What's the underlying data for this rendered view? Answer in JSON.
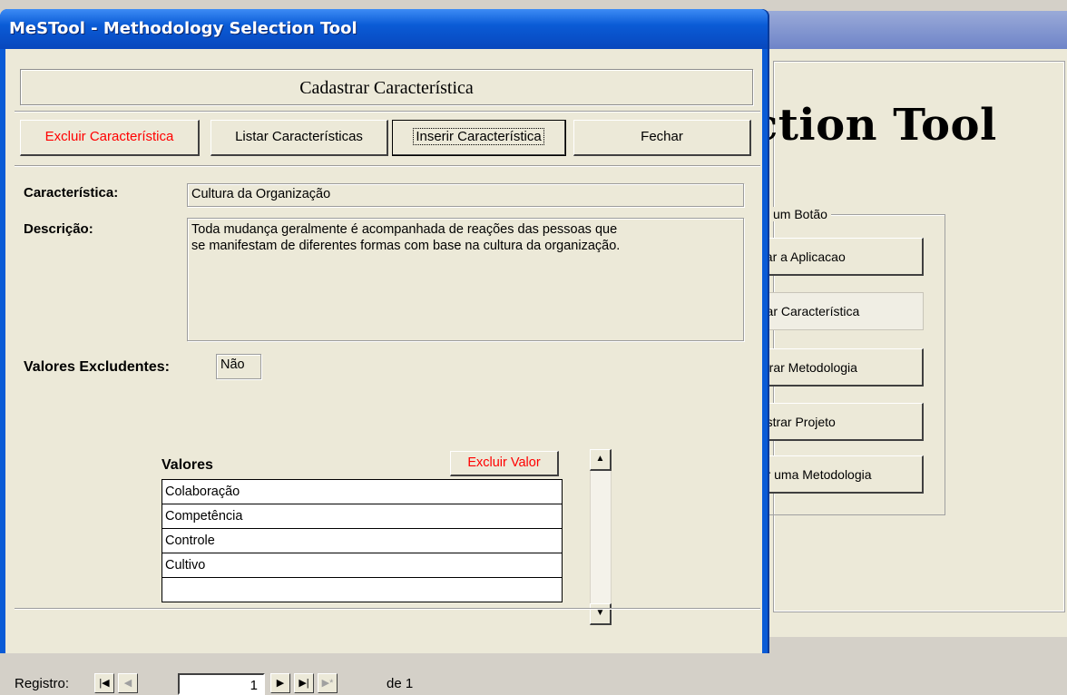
{
  "background_window": {
    "big_title": "ction Tool",
    "group_legend": "um Botão",
    "buttons": [
      {
        "label": "char a Aplicacao"
      },
      {
        "label": "strar Característica"
      },
      {
        "label": "astrar Metodologia"
      },
      {
        "label": "dastrar Projeto"
      },
      {
        "label": "nar uma Metodologia"
      }
    ]
  },
  "window": {
    "title": "MeSTool - Methodology Selection Tool"
  },
  "form": {
    "header": "Cadastrar Característica",
    "toolbar": {
      "delete_label": "Excluir Característica",
      "list_label": "Listar Características",
      "insert_label": "Inserir Característica",
      "close_label": "Fechar"
    },
    "caracteristica_label": "Característica:",
    "caracteristica_value": "Cultura da Organização",
    "descricao_label": "Descrição:",
    "descricao_value": "Toda mudança geralmente é acompanhada de reações das pessoas que\nse manifestam de diferentes formas com base na cultura da organização.",
    "excludentes_label": "Valores Excludentes:",
    "excludentes_value": "Não",
    "valores": {
      "header": "Valores",
      "delete_label": "Excluir Valor",
      "rows": [
        "Colaboração",
        "Competência",
        "Controle",
        "Cultivo",
        ""
      ]
    },
    "nav": {
      "label": "Registro:",
      "current": "1",
      "total_text": "de 1"
    }
  },
  "colors": {
    "titlebar": "#0a5bd6",
    "client_bg": "#ece9d8",
    "danger_text": "#ff0000"
  }
}
